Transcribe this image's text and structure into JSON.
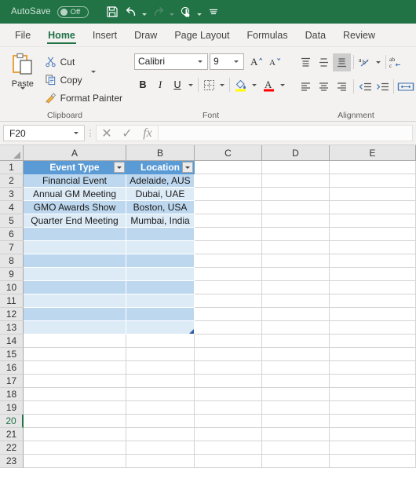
{
  "titlebar": {
    "autosave_label": "AutoSave",
    "autosave_state": "Off",
    "qat": [
      {
        "name": "save-icon",
        "label": "Save"
      },
      {
        "name": "undo-icon",
        "label": "Undo"
      },
      {
        "name": "redo-icon",
        "label": "Redo"
      },
      {
        "name": "touch-mode-icon",
        "label": "Touch/Mouse Mode"
      },
      {
        "name": "customize-quick-access-toolbar-icon",
        "label": "Customize Quick Access Toolbar"
      }
    ]
  },
  "tabs": [
    {
      "label": "File",
      "active": false
    },
    {
      "label": "Home",
      "active": true
    },
    {
      "label": "Insert",
      "active": false
    },
    {
      "label": "Draw",
      "active": false
    },
    {
      "label": "Page Layout",
      "active": false
    },
    {
      "label": "Formulas",
      "active": false
    },
    {
      "label": "Data",
      "active": false
    },
    {
      "label": "Review",
      "active": false
    }
  ],
  "ribbon": {
    "clipboard": {
      "group_label": "Clipboard",
      "paste_label": "Paste",
      "cut_label": "Cut",
      "copy_label": "Copy",
      "format_painter_label": "Format Painter"
    },
    "font": {
      "group_label": "Font",
      "font_family": "Calibri",
      "font_size": "9",
      "grow_font_label": "A",
      "shrink_font_label": "A",
      "bold_label": "B",
      "italic_label": "I",
      "underline_label": "U",
      "borders_label": "Borders",
      "fill_color_label": "Fill Color",
      "fill_color": "#ffff00",
      "font_color_label": "Font Color",
      "font_color": "#ff0000"
    },
    "alignment": {
      "group_label": "Alignment",
      "top_align_label": "Top Align",
      "middle_align_label": "Middle Align",
      "bottom_align_label": "Bottom Align",
      "orientation_label": "Orientation",
      "align_left_label": "Align Left",
      "center_label": "Center",
      "align_right_label": "Align Right",
      "decrease_indent_label": "Decrease Indent",
      "increase_indent_label": "Increase Indent",
      "wrap_text_label": "Wrap Text",
      "merge_center_label": "Merge & Center"
    }
  },
  "formula_bar": {
    "name_box_value": "F20",
    "cancel_label": "✕",
    "enter_label": "✓",
    "function_label": "fx",
    "formula_value": ""
  },
  "grid": {
    "active_cell": "F20",
    "active_row": 20,
    "columns": [
      "A",
      "B",
      "C",
      "D",
      "E"
    ],
    "row_numbers": [
      1,
      2,
      3,
      4,
      5,
      6,
      7,
      8,
      9,
      10,
      11,
      12,
      13,
      14,
      15,
      16,
      17,
      18,
      19,
      20,
      21,
      22,
      23
    ],
    "table": {
      "headers": [
        "Event Type",
        "Location"
      ],
      "rows": [
        [
          "Financial Event",
          "Adelaide, AUS"
        ],
        [
          "Annual GM Meeting",
          "Dubai, UAE"
        ],
        [
          "GMO Awards Show",
          "Boston, USA"
        ],
        [
          "Quarter End Meeting",
          "Mumbai, India"
        ]
      ],
      "empty_banded_rows": 8,
      "header_fill": "#5b9bd5",
      "band_a": "#bdd7ee",
      "band_b": "#ddebf7",
      "last_row": 13
    }
  }
}
